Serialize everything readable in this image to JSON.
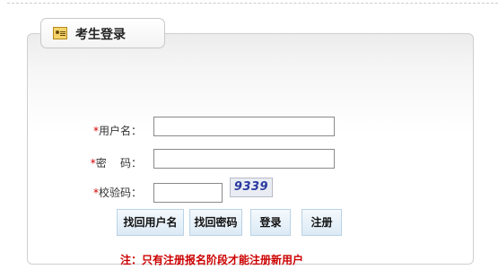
{
  "panel": {
    "title": "考生登录",
    "icon": "id-card-icon"
  },
  "form": {
    "required_mark": "*",
    "username_label": "用户名：",
    "password_label": "密    码：",
    "captcha_label": "校验码：",
    "username_value": "",
    "password_value": "",
    "captcha_value": "",
    "captcha_text": "9339"
  },
  "buttons": {
    "find_username": "找回用户名",
    "find_password": "找回密码",
    "login": "登录",
    "register": "注册"
  },
  "note": "注：只有注册报名阶段才能注册新用户",
  "colors": {
    "required": "#d40000",
    "note": "#cc0000",
    "button_border": "#b9d3e6"
  }
}
